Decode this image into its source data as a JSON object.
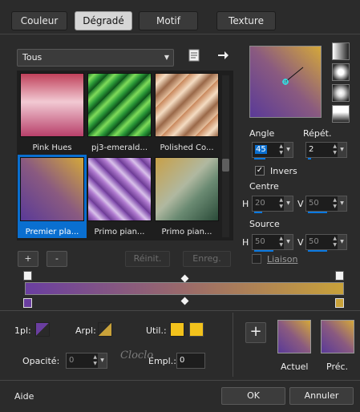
{
  "tabs": [
    {
      "label": "Couleur"
    },
    {
      "label": "Dégradé"
    },
    {
      "label": "Motif"
    },
    {
      "label": "Texture"
    }
  ],
  "active_tab": "Dégradé",
  "category_select": {
    "value": "Tous"
  },
  "gallery": [
    {
      "label": "Pink Hues"
    },
    {
      "label": "pj3-emerald..."
    },
    {
      "label": "Polished Co..."
    },
    {
      "label": "Premier pla..."
    },
    {
      "label": "Primo pian..."
    },
    {
      "label": "Primo pian..."
    }
  ],
  "selected_gradient": "Premier pla...",
  "buttons": {
    "add": "+",
    "remove": "-",
    "reset": "Réinit.",
    "save": "Enreg.",
    "ok": "OK",
    "cancel": "Annuler",
    "help": "Aide",
    "add_swatch": "+"
  },
  "options": {
    "angle_label": "Angle",
    "angle_value": "45",
    "repeat_label": "Répét.",
    "repeat_value": "2",
    "invert_label": "Invers",
    "invert_checked": true,
    "center_label": "Centre",
    "center_h_label": "H",
    "center_h_value": "20",
    "center_v_label": "V",
    "center_v_value": "50",
    "source_label": "Source",
    "source_h_label": "H",
    "source_h_value": "50",
    "source_v_label": "V",
    "source_v_value": "50",
    "link_label": "Liaison",
    "link_checked": false
  },
  "stops": {
    "fg_label": "1pl:",
    "bg_label": "Arpl:",
    "user_label": "Util.:",
    "opacity_label": "Opacité:",
    "opacity_value": "0",
    "location_label": "Empl.:",
    "location_value": "0"
  },
  "swatches": {
    "current_label": "Actuel",
    "previous_label": "Préc."
  },
  "colors": {
    "purple": "#6a3ea0",
    "gold": "#c9a23a",
    "user_yellow": "#f2c21c",
    "selection": "#0a6fd0",
    "accent_blue": "#0a78e0"
  },
  "watermark": "Cloclo",
  "icons": [
    "browse-folder-icon",
    "arrow-right-icon",
    "linear-style-icon",
    "rectangular-style-icon",
    "sunburst-style-icon",
    "radial-style-icon",
    "cursor-icon"
  ]
}
